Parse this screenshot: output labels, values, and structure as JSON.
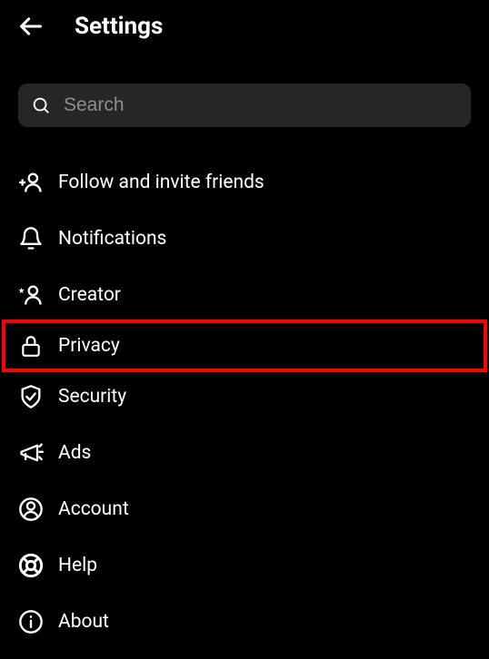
{
  "header": {
    "title": "Settings"
  },
  "search": {
    "placeholder": "Search"
  },
  "menu": {
    "items": [
      {
        "label": "Follow and invite friends"
      },
      {
        "label": "Notifications"
      },
      {
        "label": "Creator"
      },
      {
        "label": "Privacy",
        "highlighted": true
      },
      {
        "label": "Security"
      },
      {
        "label": "Ads"
      },
      {
        "label": "Account"
      },
      {
        "label": "Help"
      },
      {
        "label": "About"
      }
    ]
  }
}
